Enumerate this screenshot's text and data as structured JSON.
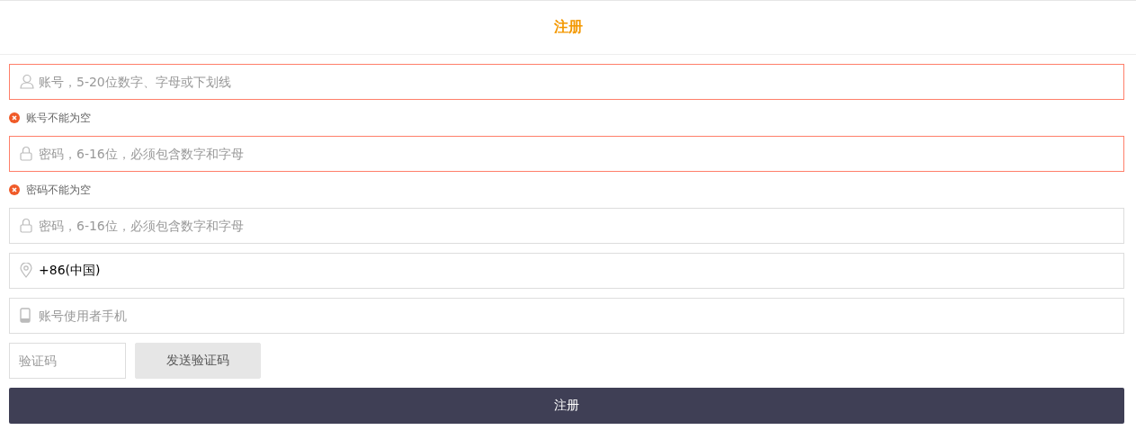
{
  "header": {
    "title": "注册"
  },
  "fields": [
    {
      "kind": "user",
      "placeholder": "账号，5-20位数字、字母或下划线",
      "error": "账号不能为空"
    },
    {
      "kind": "lock",
      "placeholder": "密码，6-16位，必须包含数字和字母",
      "error": "密码不能为空"
    },
    {
      "kind": "lock",
      "placeholder": "密码，6-16位，必须包含数字和字母"
    },
    {
      "kind": "location",
      "value": "+86(中国)"
    },
    {
      "kind": "phone",
      "placeholder": "账号使用者手机"
    }
  ],
  "code": {
    "placeholder": "验证码",
    "send_button": "发送验证码"
  },
  "submit": "注册"
}
